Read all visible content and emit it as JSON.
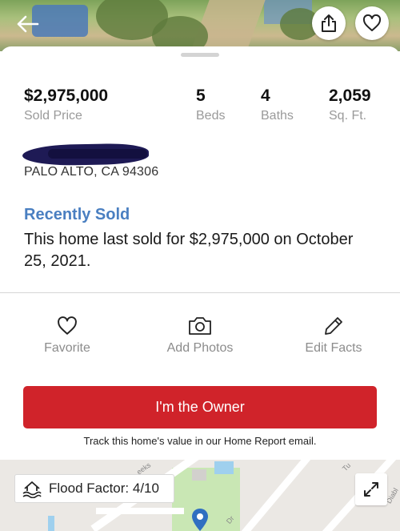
{
  "header": {
    "back_icon": "back-arrow-icon",
    "share_icon": "share-icon",
    "favorite_icon": "heart-icon"
  },
  "stats": {
    "price": {
      "value": "$2,975,000",
      "label": "Sold Price"
    },
    "beds": {
      "value": "5",
      "label": "Beds"
    },
    "baths": {
      "value": "4",
      "label": "Baths"
    },
    "sqft": {
      "value": "2,059",
      "label": "Sq. Ft."
    }
  },
  "address": {
    "city_line": "PALO ALTO, CA 94306"
  },
  "sale": {
    "title": "Recently Sold",
    "text": "This home last sold for $2,975,000 on October 25, 2021."
  },
  "actions": [
    {
      "label": "Favorite",
      "icon": "heart-icon"
    },
    {
      "label": "Add Photos",
      "icon": "camera-icon"
    },
    {
      "label": "Edit Facts",
      "icon": "pencil-icon"
    }
  ],
  "owner": {
    "button_label": "I'm the Owner",
    "note": "Track this home's value in our Home Report email."
  },
  "map": {
    "flood_factor": "Flood Factor: 4/10",
    "road_labels": [
      "eeks",
      "Dr",
      "Diabl",
      "Tu"
    ]
  },
  "colors": {
    "accent_red": "#d0232a",
    "link_blue": "#4a7fc1"
  }
}
